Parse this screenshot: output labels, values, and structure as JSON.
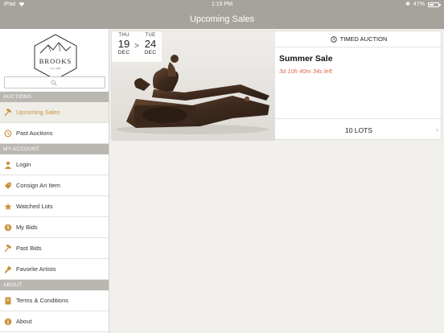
{
  "status_bar": {
    "device": "iPad",
    "time": "1:19 PM",
    "battery": "47%"
  },
  "nav": {
    "title": "Upcoming Sales"
  },
  "sidebar": {
    "logo_text": "BROOKS",
    "logo_subtext": "since 1983",
    "search_placeholder": "",
    "sections": {
      "auctions": "AUCTIONS",
      "my_account": "MY ACCOUNT",
      "about": "ABOUT"
    },
    "items": {
      "upcoming_sales": "Upcoming Sales",
      "past_auctions": "Past Auctions",
      "login": "Login",
      "consign": "Consign An Item",
      "watched": "Watched Lots",
      "my_bids": "My Bids",
      "past_bids": "Past Bids",
      "favorite_artists": "Favorite Artists",
      "terms": "Terms & Conditions",
      "about": "About"
    },
    "accent_color": "#c8913a"
  },
  "sale": {
    "start": {
      "weekday": "THU",
      "day": "19",
      "month": "DEC"
    },
    "end": {
      "weekday": "TUE",
      "day": "24",
      "month": "DEC"
    },
    "range_separator": ">",
    "type_label": "TIMED AUCTION",
    "title": "Summer Sale",
    "time_left": "3d 10h 40m 34s left",
    "lots": "10 LOTS"
  }
}
